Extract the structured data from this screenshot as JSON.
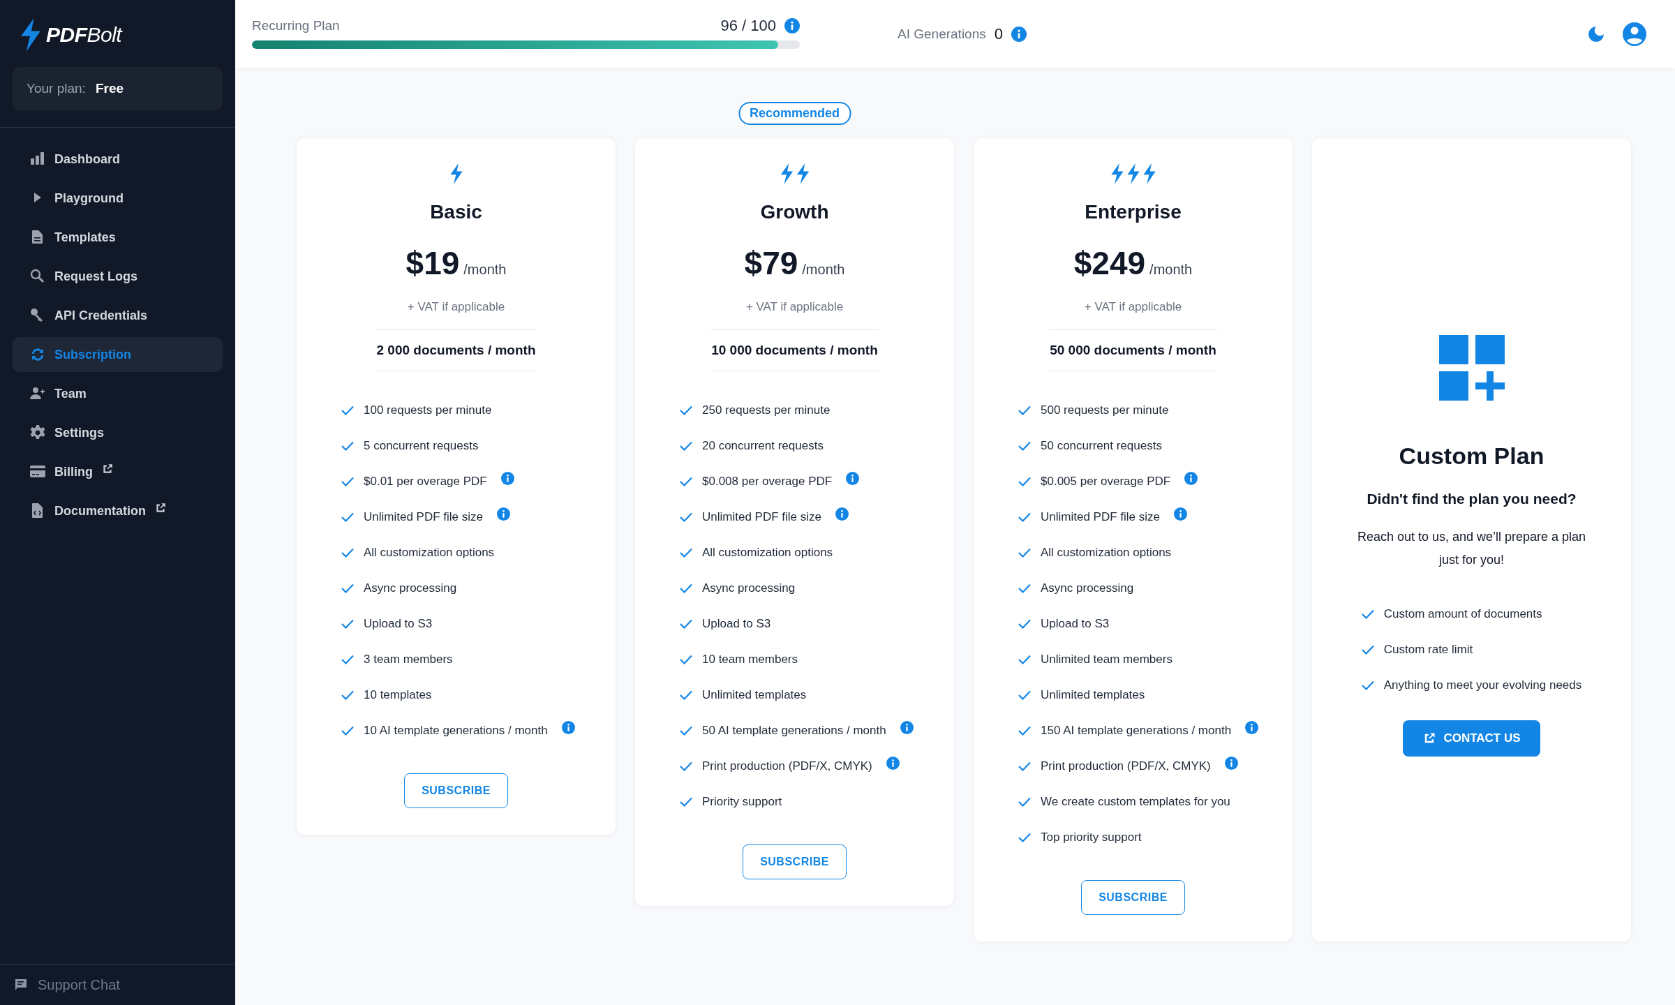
{
  "sidebar": {
    "logo": "**PDF**Bolt",
    "plan_label": "Your plan:",
    "plan_value": "Free",
    "items": [
      {
        "label": "Dashboard",
        "selected": false,
        "external": false
      },
      {
        "label": "Playground",
        "selected": false,
        "external": false
      },
      {
        "label": "Templates",
        "selected": false,
        "external": false
      },
      {
        "label": "Request Logs",
        "selected": false,
        "external": false
      },
      {
        "label": "API Credentials",
        "selected": false,
        "external": false
      },
      {
        "label": "Subscription",
        "selected": true,
        "external": false
      },
      {
        "label": "Team",
        "selected": false,
        "external": false
      },
      {
        "label": "Settings",
        "selected": false,
        "external": false
      },
      {
        "label": "Billing",
        "selected": false,
        "external": true
      },
      {
        "label": "Documentation",
        "selected": false,
        "external": true
      }
    ],
    "support": "Support Chat"
  },
  "topbar": {
    "plan_label": "Recurring Plan",
    "plan_count": "96 / 100",
    "level": 0.96,
    "ai_label": "AI Generations",
    "ai_count": "0"
  },
  "plans": [
    {
      "kind": "basic",
      "name": "Basic",
      "price": "$19",
      "period": "/month",
      "vat": "+ VAT if applicable",
      "documents": "2 000 documents / month",
      "features": [
        {
          "text": "100 requests per minute",
          "info": false
        },
        {
          "text": "5 concurrent requests",
          "info": false
        },
        {
          "text": "$0.01 per overage PDF",
          "info": true
        },
        {
          "text": "Unlimited PDF file size",
          "info": true
        },
        {
          "text": "All customization options",
          "info": false
        },
        {
          "text": "Async processing",
          "info": false
        },
        {
          "text": "Upload to S3",
          "info": false
        },
        {
          "text": "3 team members",
          "info": false
        },
        {
          "text": "10 templates",
          "info": false
        },
        {
          "text": "10 AI template generations / month",
          "info": true
        }
      ],
      "button": "SUBSCRIBE"
    },
    {
      "kind": "growth",
      "badge": "Recommended",
      "name": "Growth",
      "price": "$79",
      "period": "/month",
      "vat": "+ VAT if applicable",
      "documents": "10 000 documents / month",
      "features": [
        {
          "text": "250 requests per minute",
          "info": false
        },
        {
          "text": "20 concurrent requests",
          "info": false
        },
        {
          "text": "$0.008 per overage PDF",
          "info": true
        },
        {
          "text": "Unlimited PDF file size",
          "info": true
        },
        {
          "text": "All customization options",
          "info": false
        },
        {
          "text": "Async processing",
          "info": false
        },
        {
          "text": "Upload to S3",
          "info": false
        },
        {
          "text": "10 team members",
          "info": false
        },
        {
          "text": "Unlimited templates",
          "info": false
        },
        {
          "text": "50 AI template generations / month",
          "info": true
        },
        {
          "text": "Print production (PDF/X, CMYK)",
          "info": true
        },
        {
          "text": "Priority support",
          "info": false
        }
      ],
      "button": "SUBSCRIBE"
    },
    {
      "kind": "enterprise",
      "name": "Enterprise",
      "price": "$249",
      "period": "/month",
      "vat": "+ VAT if applicable",
      "documents": "50 000 documents / month",
      "features": [
        {
          "text": "500 requests per minute",
          "info": false
        },
        {
          "text": "50 concurrent requests",
          "info": false
        },
        {
          "text": "$0.005 per overage PDF",
          "info": true
        },
        {
          "text": "Unlimited PDF file size",
          "info": true
        },
        {
          "text": "All customization options",
          "info": false
        },
        {
          "text": "Async processing",
          "info": false
        },
        {
          "text": "Upload to S3",
          "info": false
        },
        {
          "text": "Unlimited team members",
          "info": false
        },
        {
          "text": "Unlimited templates",
          "info": false
        },
        {
          "text": "150 AI template generations / month",
          "info": true
        },
        {
          "text": "Print production (PDF/X, CMYK)",
          "info": true
        },
        {
          "text": "We create custom templates for you",
          "info": false
        },
        {
          "text": "Top priority support",
          "info": false
        }
      ],
      "button": "SUBSCRIBE"
    },
    {
      "kind": "custom",
      "name": "Custom Plan",
      "subtitle": "Didn't find the plan you need?",
      "description": "Reach out to us, and we’ll prepare a plan just for you!",
      "features": [
        {
          "text": "Custom amount of documents",
          "info": false
        },
        {
          "text": "Custom rate limit",
          "info": false
        },
        {
          "text": "Anything to meet your evolving needs",
          "info": false
        }
      ],
      "button": "CONTACT US"
    }
  ]
}
